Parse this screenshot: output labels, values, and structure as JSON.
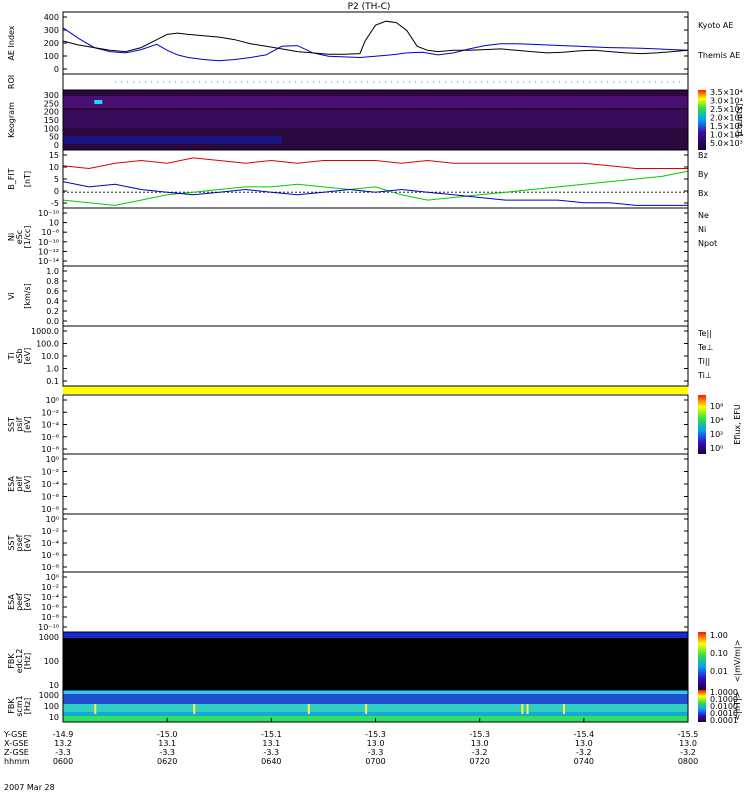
{
  "title": "P2 (TH-C)",
  "date_label": "2007 Mar 28",
  "chart_data": [
    {
      "type": "line",
      "id": "ae",
      "ylabel": "AE Index",
      "ylim": [
        -50,
        420
      ],
      "yticks": [
        "400",
        "300",
        "200",
        "100",
        "0"
      ],
      "x_range_hhmm": [
        "0600",
        "0800"
      ],
      "series": [
        {
          "name": "Kyoto AE",
          "color": "#0000cc",
          "t": [
            0,
            3,
            6,
            9,
            12,
            15,
            18,
            20,
            22,
            24,
            27,
            30,
            33,
            36,
            39,
            42,
            45,
            48,
            51,
            54,
            57,
            60,
            63,
            66,
            69,
            72,
            75,
            78,
            81,
            84,
            87,
            90,
            93,
            96,
            99,
            102,
            105,
            108,
            111,
            114,
            117,
            120
          ],
          "v": [
            300,
            220,
            150,
            120,
            110,
            135,
            175,
            130,
            95,
            75,
            60,
            50,
            60,
            75,
            95,
            160,
            165,
            110,
            85,
            80,
            75,
            85,
            95,
            110,
            115,
            95,
            110,
            140,
            165,
            180,
            180,
            175,
            170,
            165,
            160,
            155,
            150,
            148,
            145,
            140,
            135,
            130
          ]
        },
        {
          "name": "Themis AE",
          "color": "#000000",
          "t": [
            0,
            3,
            6,
            9,
            12,
            15,
            18,
            20,
            22,
            24,
            27,
            30,
            33,
            36,
            39,
            42,
            45,
            48,
            51,
            54,
            57,
            58,
            60,
            62,
            64,
            66,
            68,
            70,
            72,
            75,
            78,
            81,
            84,
            87,
            90,
            93,
            96,
            99,
            102,
            105,
            108,
            111,
            114,
            117,
            120
          ],
          "v": [
            200,
            170,
            150,
            130,
            120,
            150,
            210,
            250,
            260,
            250,
            240,
            230,
            210,
            180,
            160,
            140,
            120,
            110,
            100,
            100,
            105,
            200,
            320,
            350,
            340,
            280,
            160,
            130,
            120,
            130,
            130,
            135,
            140,
            130,
            120,
            110,
            115,
            125,
            130,
            120,
            110,
            105,
            110,
            120,
            130
          ]
        }
      ]
    },
    {
      "type": "table",
      "id": "roi",
      "ylabel": "ROI"
    },
    {
      "type": "heatmap",
      "id": "keogram",
      "ylabel": "Keogram",
      "ylim": [
        0,
        300
      ],
      "yticks": [
        "300",
        "250",
        "200",
        "150",
        "100",
        "50",
        "0"
      ],
      "colorbar_ticks": [
        "3.5×10⁴",
        "3.0×10⁴",
        "2.5×10⁴",
        "2.0×10⁴",
        "1.5×10⁴",
        "1.0×10⁴",
        "5.0×10³"
      ],
      "colorbar_label": "[counts]"
    },
    {
      "type": "line",
      "id": "bfield",
      "ylabel": "B_FIT",
      "yunit": "[nT]",
      "ylim": [
        -6,
        16
      ],
      "yticks": [
        "15",
        "10",
        "5",
        "0",
        "-5"
      ],
      "series": [
        {
          "name": "Bz",
          "color": "#dd0000",
          "t": [
            0,
            5,
            10,
            15,
            20,
            25,
            30,
            35,
            40,
            45,
            50,
            55,
            60,
            65,
            70,
            75,
            80,
            85,
            90,
            95,
            100,
            105,
            110,
            115,
            120
          ],
          "v": [
            10,
            9,
            11,
            12,
            11,
            13,
            12,
            11,
            12,
            11,
            12,
            12,
            12,
            11,
            12,
            11,
            11,
            11,
            11,
            11,
            11,
            10,
            9,
            9,
            9
          ]
        },
        {
          "name": "By",
          "color": "#00cc00",
          "t": [
            0,
            5,
            10,
            15,
            20,
            25,
            30,
            35,
            40,
            45,
            50,
            55,
            60,
            65,
            70,
            75,
            80,
            85,
            90,
            95,
            100,
            105,
            110,
            115,
            120
          ],
          "v": [
            -3,
            -4,
            -5,
            -3,
            -1,
            0,
            1,
            2,
            2,
            3,
            2,
            1,
            2,
            -1,
            -3,
            -2,
            -1,
            0,
            1,
            2,
            3,
            4,
            5,
            6,
            8
          ]
        },
        {
          "name": "Bx",
          "color": "#0000cc",
          "t": [
            0,
            5,
            10,
            15,
            20,
            25,
            30,
            35,
            40,
            45,
            50,
            55,
            60,
            65,
            70,
            75,
            80,
            85,
            90,
            95,
            100,
            105,
            110,
            115,
            120
          ],
          "v": [
            4,
            2,
            3,
            1,
            0,
            -1,
            0,
            1,
            0,
            -1,
            0,
            1,
            0,
            1,
            0,
            -1,
            -2,
            -3,
            -3,
            -3,
            -4,
            -4,
            -5,
            -5,
            -5
          ]
        }
      ]
    },
    {
      "type": "line",
      "id": "ni",
      "ylabel": "Ni",
      "ysub": "eSc",
      "yunit": "[1/cc]",
      "yticks": [
        "10⁻¹⁰",
        "10",
        "10⁻⁸",
        "10⁻¹⁰",
        "10⁻¹²",
        "10⁻¹⁴"
      ],
      "legend": [
        {
          "name": "Ne",
          "color": "#dd0000"
        },
        {
          "name": "Ni",
          "color": "#000000"
        },
        {
          "name": "Npot",
          "color": "#0000cc"
        }
      ]
    },
    {
      "type": "line",
      "id": "vi",
      "ylabel": "Vi",
      "yunit": "[km/s]",
      "yticks": [
        "1.0",
        "0.8",
        "0.6",
        "0.4",
        "0.2",
        "0.0"
      ]
    },
    {
      "type": "line",
      "id": "ti",
      "ylabel": "Ti",
      "ysub": "eSb",
      "yunit": "[eV]",
      "yticks": [
        "1000.0",
        "100.0",
        "10.0",
        "1.0",
        "0.1"
      ],
      "legend": [
        {
          "name": "Te||",
          "color": "#000000"
        },
        {
          "name": "Te⊥",
          "color": "#dd0000"
        },
        {
          "name": "Ti||",
          "color": "#00cc00"
        },
        {
          "name": "Ti⊥",
          "color": "#0000cc"
        }
      ]
    },
    {
      "type": "heatmap",
      "id": "sst1",
      "ylabel": "SST",
      "ysub": "psif",
      "yunit": "[eV]",
      "yticks": [
        "10⁰",
        "10⁻²",
        "10⁻⁴",
        "10⁻⁶",
        "10⁻⁸"
      ],
      "colorbar_ticks": [
        "10⁸",
        "10⁴",
        "10²",
        "10⁰"
      ],
      "colorbar_label": "Eflux, EFU"
    },
    {
      "type": "heatmap",
      "id": "esa1",
      "ylabel": "ESA",
      "ysub": "peif",
      "yunit": "[eV]",
      "yticks": [
        "10⁰",
        "10⁻²",
        "10⁻⁴",
        "10⁻⁶",
        "10⁻⁸"
      ]
    },
    {
      "type": "heatmap",
      "id": "sst2",
      "ylabel": "SST",
      "ysub": "psef",
      "yunit": "[eV]",
      "yticks": [
        "10⁰",
        "10⁻²",
        "10⁻⁴",
        "10⁻⁶",
        "10⁻⁸"
      ]
    },
    {
      "type": "heatmap",
      "id": "esa2",
      "ylabel": "ESA",
      "ysub": "peef",
      "yunit": "[eV]",
      "yticks": [
        "10⁰",
        "10⁻²",
        "10⁻⁴",
        "10⁻⁶",
        "10⁻⁸",
        "10⁻¹⁰"
      ]
    },
    {
      "type": "heatmap",
      "id": "fbk1",
      "ylabel": "FBK",
      "ysub": "edc12",
      "yunit": "[Hz]",
      "yticks": [
        "1000",
        "100",
        "10"
      ],
      "colorbar_ticks": [
        "1.00",
        "0.10",
        "0.01"
      ],
      "colorbar_label": "<|mV/m|>"
    },
    {
      "type": "heatmap",
      "id": "fbk2",
      "ylabel": "FBK",
      "ysub": "scm1",
      "yunit": "[Hz]",
      "yticks": [
        "1000",
        "100",
        "10"
      ],
      "colorbar_ticks": [
        "1.0000",
        "0.1000",
        "0.0100",
        "0.0010",
        "0.0001"
      ],
      "colorbar_label": "<|nT|>"
    }
  ],
  "x_axis": {
    "row_labels": [
      "Y-GSE",
      "X-GSE",
      "Z-GSE",
      "hhmm"
    ],
    "columns": [
      {
        "y": "-14.9",
        "x": "13.2",
        "z": "-3.3",
        "hhmm": "0600"
      },
      {
        "y": "-15.0",
        "x": "13.1",
        "z": "-3.3",
        "hhmm": "0620"
      },
      {
        "y": "-15.1",
        "x": "13.1",
        "z": "-3.3",
        "hhmm": "0640"
      },
      {
        "y": "-15.3",
        "x": "13.0",
        "z": "-3.3",
        "hhmm": "0700"
      },
      {
        "y": "-15.3",
        "x": "13.0",
        "z": "-3.2",
        "hhmm": "0720"
      },
      {
        "y": "-15.4",
        "x": "13.0",
        "z": "-3.2",
        "hhmm": "0740"
      },
      {
        "y": "-15.5",
        "x": "13.0",
        "z": "-3.2",
        "hhmm": "0800"
      }
    ]
  }
}
